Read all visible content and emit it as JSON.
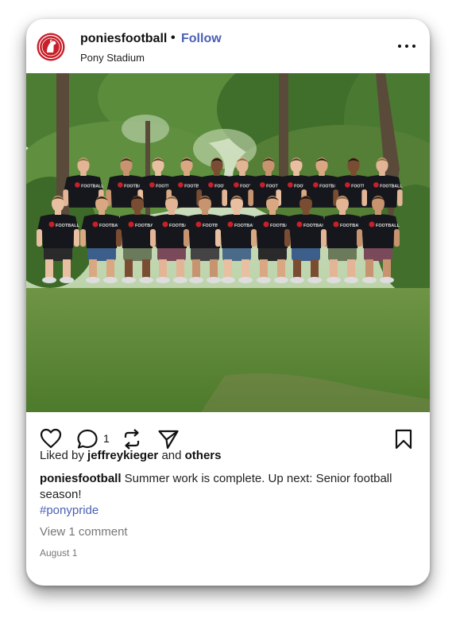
{
  "post": {
    "username": "poniesfootball",
    "separator": "•",
    "follow_label": "Follow",
    "location": "Pony Stadium",
    "comment_count": "1",
    "liked_by_prefix": "Liked by",
    "liked_by_user": "jeffreykieger",
    "liked_by_and": "and",
    "liked_by_others": "others",
    "caption_user": "poniesfootball",
    "caption_text": "Summer work is complete. Up next: Senior football season!",
    "hashtag": "#ponypride",
    "view_comments": "View 1 comment",
    "date": "August 1",
    "shirt_logo_text": "FOOTBALL"
  },
  "colors": {
    "follow": "#4a5fb5",
    "avatar_red": "#c8202a",
    "shirt": "#15171c",
    "grass": "#5f8a3a",
    "foliage": "#3f6f2a"
  },
  "icons": {
    "like": "heart-icon",
    "comment": "comment-bubble-icon",
    "repost": "repost-icon",
    "share": "send-icon",
    "save": "bookmark-icon",
    "more": "more-options-icon",
    "avatar": "ponies-logo"
  }
}
